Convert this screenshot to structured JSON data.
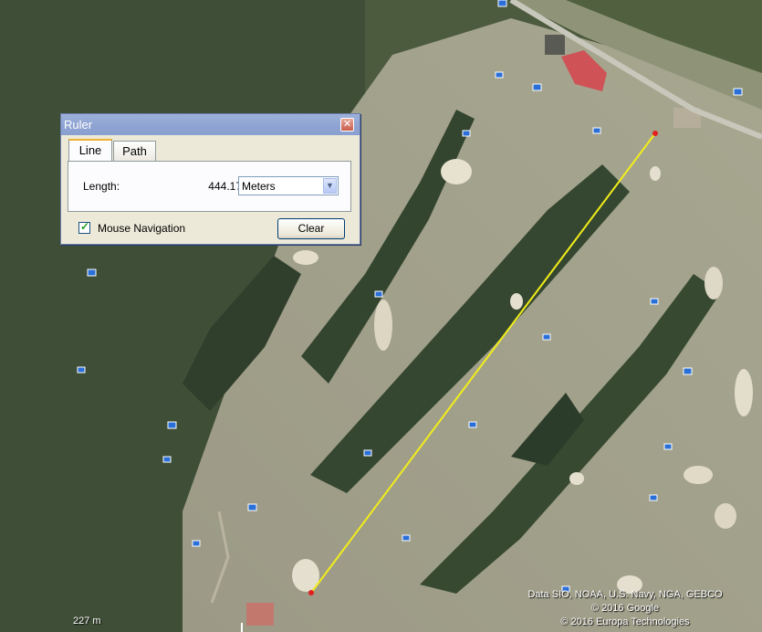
{
  "ruler": {
    "title": "Ruler",
    "close_glyph": "✕",
    "tabs": [
      {
        "label": "Line",
        "active": true
      },
      {
        "label": "Path",
        "active": false
      }
    ],
    "length_label": "Length:",
    "length_value": "444.17",
    "unit_selected": "Meters",
    "mouse_navigation_label": "Mouse Navigation",
    "mouse_navigation_checked": true,
    "clear_label": "Clear"
  },
  "map": {
    "measure_line_color": "#f2ee1a",
    "credits": [
      "Data SIO, NOAA, U.S. Navy, NGA, GEBCO",
      "© 2016 Google",
      "© 2016 Europa Technologies"
    ],
    "scale_label": "227 m"
  }
}
